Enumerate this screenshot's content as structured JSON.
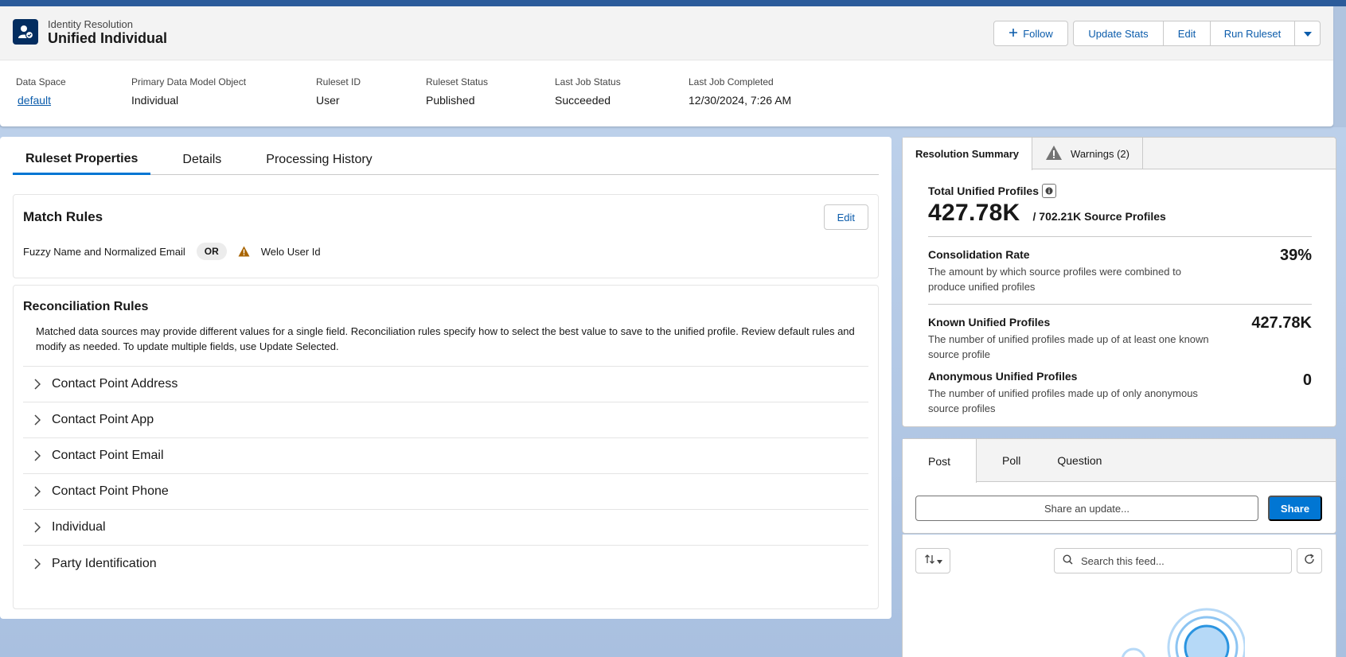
{
  "header": {
    "object_label": "Identity Resolution",
    "title": "Unified Individual",
    "buttons": {
      "follow": "Follow",
      "update_stats": "Update Stats",
      "edit": "Edit",
      "run_ruleset": "Run Ruleset"
    }
  },
  "highlights": [
    {
      "label": "Data Space",
      "value": "default"
    },
    {
      "label": "Primary Data Model Object",
      "value": "Individual"
    },
    {
      "label": "Ruleset ID",
      "value": "User"
    },
    {
      "label": "Ruleset Status",
      "value": "Published"
    },
    {
      "label": "Last Job Status",
      "value": "Succeeded"
    },
    {
      "label": "Last Job Completed",
      "value": "12/30/2024, 7:26 AM"
    }
  ],
  "main_tabs": [
    "Ruleset Properties",
    "Details",
    "Processing History"
  ],
  "match_rules": {
    "title": "Match Rules",
    "edit_label": "Edit",
    "rule_1": "Fuzzy Name and Normalized Email",
    "operator": "OR",
    "rule_2": "Welo User Id"
  },
  "reconciliation": {
    "title": "Reconciliation Rules",
    "description": "Matched data sources may provide different values for a single field. Reconciliation rules specify how to select the best value to save to the unified profile. Review default rules and modify as needed. To update multiple fields, use Update Selected.",
    "items": [
      "Contact Point Address",
      "Contact Point App",
      "Contact Point Email",
      "Contact Point Phone",
      "Individual",
      "Party Identification"
    ]
  },
  "summary": {
    "tabs": {
      "resolution": "Resolution Summary",
      "warnings": "Warnings (2)"
    },
    "total_label": "Total Unified Profiles",
    "total_value": "427.78K",
    "source_profiles": "/ 702.21K Source Profiles",
    "consolidation": {
      "title": "Consolidation Rate",
      "desc": "The amount by which source profiles were combined to produce unified profiles",
      "value": "39%"
    },
    "known": {
      "title": "Known Unified Profiles",
      "desc": "The number of unified profiles made up of at least one known source profile",
      "value": "427.78K"
    },
    "anonymous": {
      "title": "Anonymous Unified Profiles",
      "desc": "The number of unified profiles made up of only anonymous source profiles",
      "value": "0"
    }
  },
  "publisher": {
    "tabs": [
      "Post",
      "Poll",
      "Question"
    ],
    "placeholder": "Share an update...",
    "share_label": "Share"
  },
  "feed": {
    "search_placeholder": "Search this feed..."
  },
  "colors": {
    "brand_blue": "#0176d3",
    "link_blue": "#0b5cab",
    "icon_navy": "#032d60",
    "warning": "#a86403"
  }
}
